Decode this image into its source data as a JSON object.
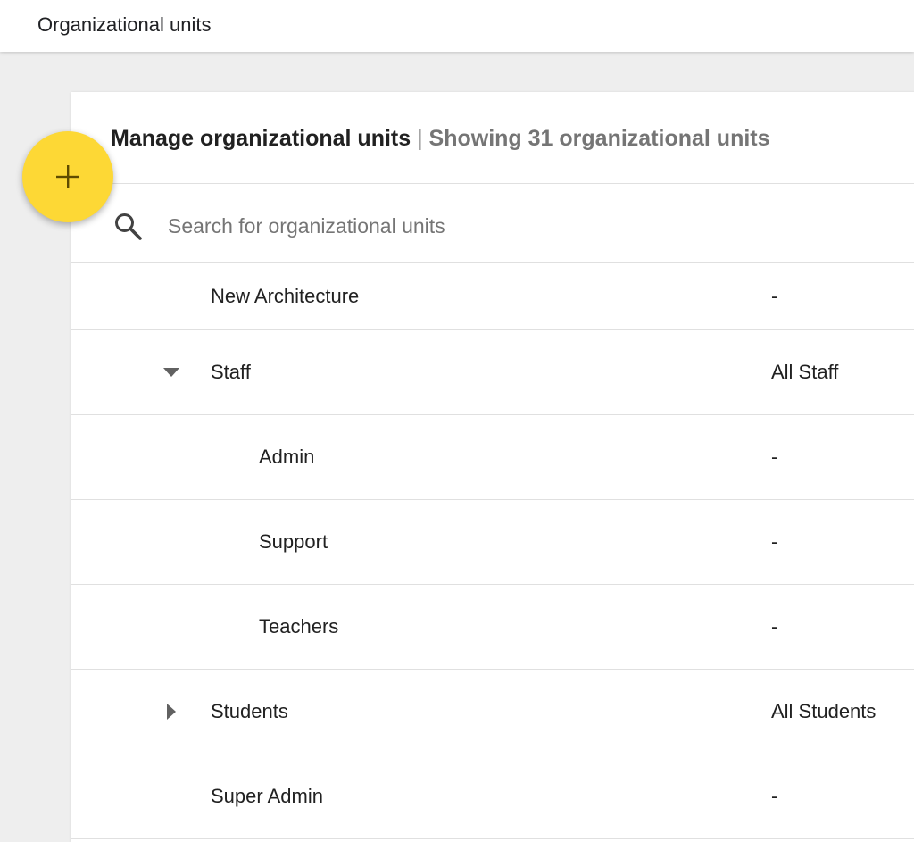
{
  "header": {
    "title": "Organizational units"
  },
  "card": {
    "title": "Manage organizational units",
    "separator": " | ",
    "subtitle": "Showing 31 organizational units"
  },
  "search": {
    "placeholder": "Search for organizational units",
    "value": "",
    "icon": "search-icon"
  },
  "fab": {
    "icon": "plus-icon",
    "color": "#fdd835"
  },
  "rows": [
    {
      "name": "New Architecture",
      "value": "-",
      "level": 1,
      "toggle": null
    },
    {
      "name": "Staff",
      "value": "All Staff",
      "level": 1,
      "toggle": "expanded"
    },
    {
      "name": "Admin",
      "value": "-",
      "level": 2,
      "toggle": null
    },
    {
      "name": "Support",
      "value": "-",
      "level": 2,
      "toggle": null
    },
    {
      "name": "Teachers",
      "value": "-",
      "level": 2,
      "toggle": null
    },
    {
      "name": "Students",
      "value": "All Students",
      "level": 1,
      "toggle": "collapsed"
    },
    {
      "name": "Super Admin",
      "value": "-",
      "level": 1,
      "toggle": null
    }
  ]
}
